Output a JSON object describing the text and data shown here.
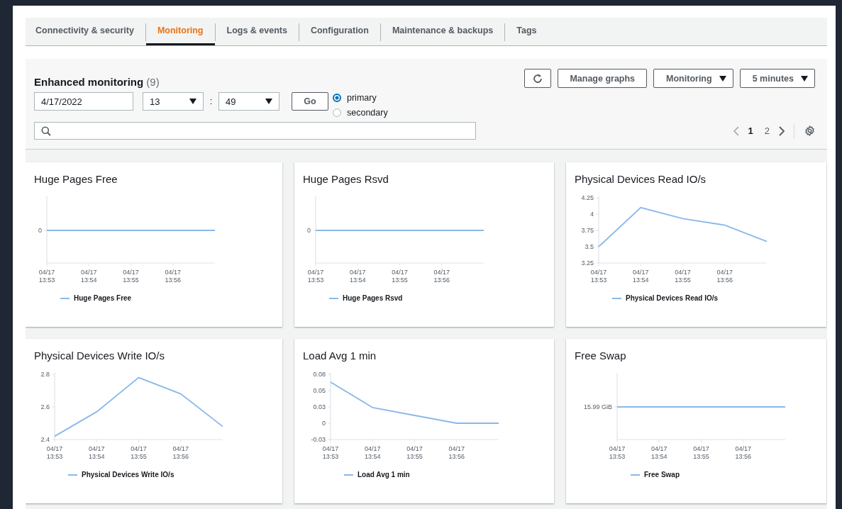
{
  "tabs": [
    {
      "label": "Connectivity & security",
      "selected": false
    },
    {
      "label": "Monitoring",
      "selected": true
    },
    {
      "label": "Logs & events",
      "selected": false
    },
    {
      "label": "Configuration",
      "selected": false
    },
    {
      "label": "Maintenance & backups",
      "selected": false
    },
    {
      "label": "Tags",
      "selected": false
    }
  ],
  "header": {
    "title": "Enhanced monitoring",
    "count": "(9)",
    "date": "4/17/2022",
    "hour": "13",
    "separator": ":",
    "minute": "49",
    "go": "Go",
    "instances": [
      {
        "label": "primary",
        "selected": true
      },
      {
        "label": "secondary",
        "selected": false
      }
    ],
    "buttons": [
      {
        "kind": "refresh"
      },
      {
        "kind": "text",
        "label": "Manage graphs"
      },
      {
        "kind": "dropdown",
        "label": "Monitoring"
      },
      {
        "kind": "dropdown",
        "label": "5 minutes"
      }
    ],
    "pages": [
      {
        "label": "1",
        "selected": true
      },
      {
        "label": "2",
        "selected": false
      }
    ]
  },
  "charts": [
    {
      "kind": "flat-plot",
      "title": "Huge Pages Free",
      "y_label": "0",
      "x_labels": [
        "04/17 13:53",
        "04/17 13:54",
        "04/17 13:55",
        "04/17 13:56"
      ],
      "legend": "Huge Pages Free"
    },
    {
      "kind": "flat-plot",
      "title": "Huge Pages Rsvd",
      "y_label": "0",
      "x_labels": [
        "04/17 13:53",
        "04/17 13:54",
        "04/17 13:55",
        "04/17 13:56"
      ],
      "legend": "Huge Pages Rsvd"
    },
    {
      "kind": "chart",
      "chart_data": {
        "type": "line",
        "title": "Physical Devices Read IO/s",
        "categories": [
          "04/17 13:53",
          "04/17 13:54",
          "04/17 13:55",
          "04/17 13:56",
          null
        ],
        "ylim": [
          3.25,
          4.25
        ],
        "yticks": [
          3.25,
          3.5,
          3.75,
          4,
          4.25
        ],
        "series": [
          {
            "name": "Physical Devices Read IO/s",
            "color": "#8ab8ea",
            "values": [
              3.5,
              4.1,
              3.93,
              3.83,
              3.58
            ]
          }
        ]
      }
    },
    {
      "kind": "chart",
      "chart_data": {
        "type": "line",
        "title": "Physical Devices Write IO/s",
        "categories": [
          "04/17 13:53",
          "04/17 13:54",
          "04/17 13:55",
          "04/17 13:56",
          null
        ],
        "ylim": [
          2.4,
          2.8
        ],
        "yticks": [
          2.4,
          2.6,
          2.8
        ],
        "series": [
          {
            "name": "Physical Devices Write IO/s",
            "color": "#8ab8ea",
            "values": [
              2.42,
              2.57,
              2.78,
              2.68,
              2.48
            ]
          }
        ]
      }
    },
    {
      "kind": "chart",
      "chart_data": {
        "type": "line",
        "title": "Load Avg 1 min",
        "categories": [
          "04/17 13:53",
          "04/17 13:54",
          "04/17 13:55",
          "04/17 13:56",
          null
        ],
        "ylim": [
          -0.025,
          0.075
        ],
        "yticks": [
          {
            "value": 0.075,
            "label": "0.08"
          },
          {
            "value": 0.05,
            "label": "0.05"
          },
          {
            "value": 0.025,
            "label": "0.03"
          },
          {
            "value": 0,
            "label": "0"
          },
          {
            "value": -0.025,
            "label": "-0.03"
          }
        ],
        "series": [
          {
            "name": "Load Avg 1 min",
            "color": "#8ab8ea",
            "values": [
              0.063,
              0.024,
              0.012,
              0,
              0
            ]
          }
        ]
      }
    },
    {
      "kind": "flat-plot",
      "title": "Free Swap",
      "y_label": "15.99 GiB",
      "x_labels": [
        "04/17 13:53",
        "04/17 13:54",
        "04/17 13:55",
        "04/17 13:56"
      ],
      "legend": "Free Swap"
    }
  ]
}
